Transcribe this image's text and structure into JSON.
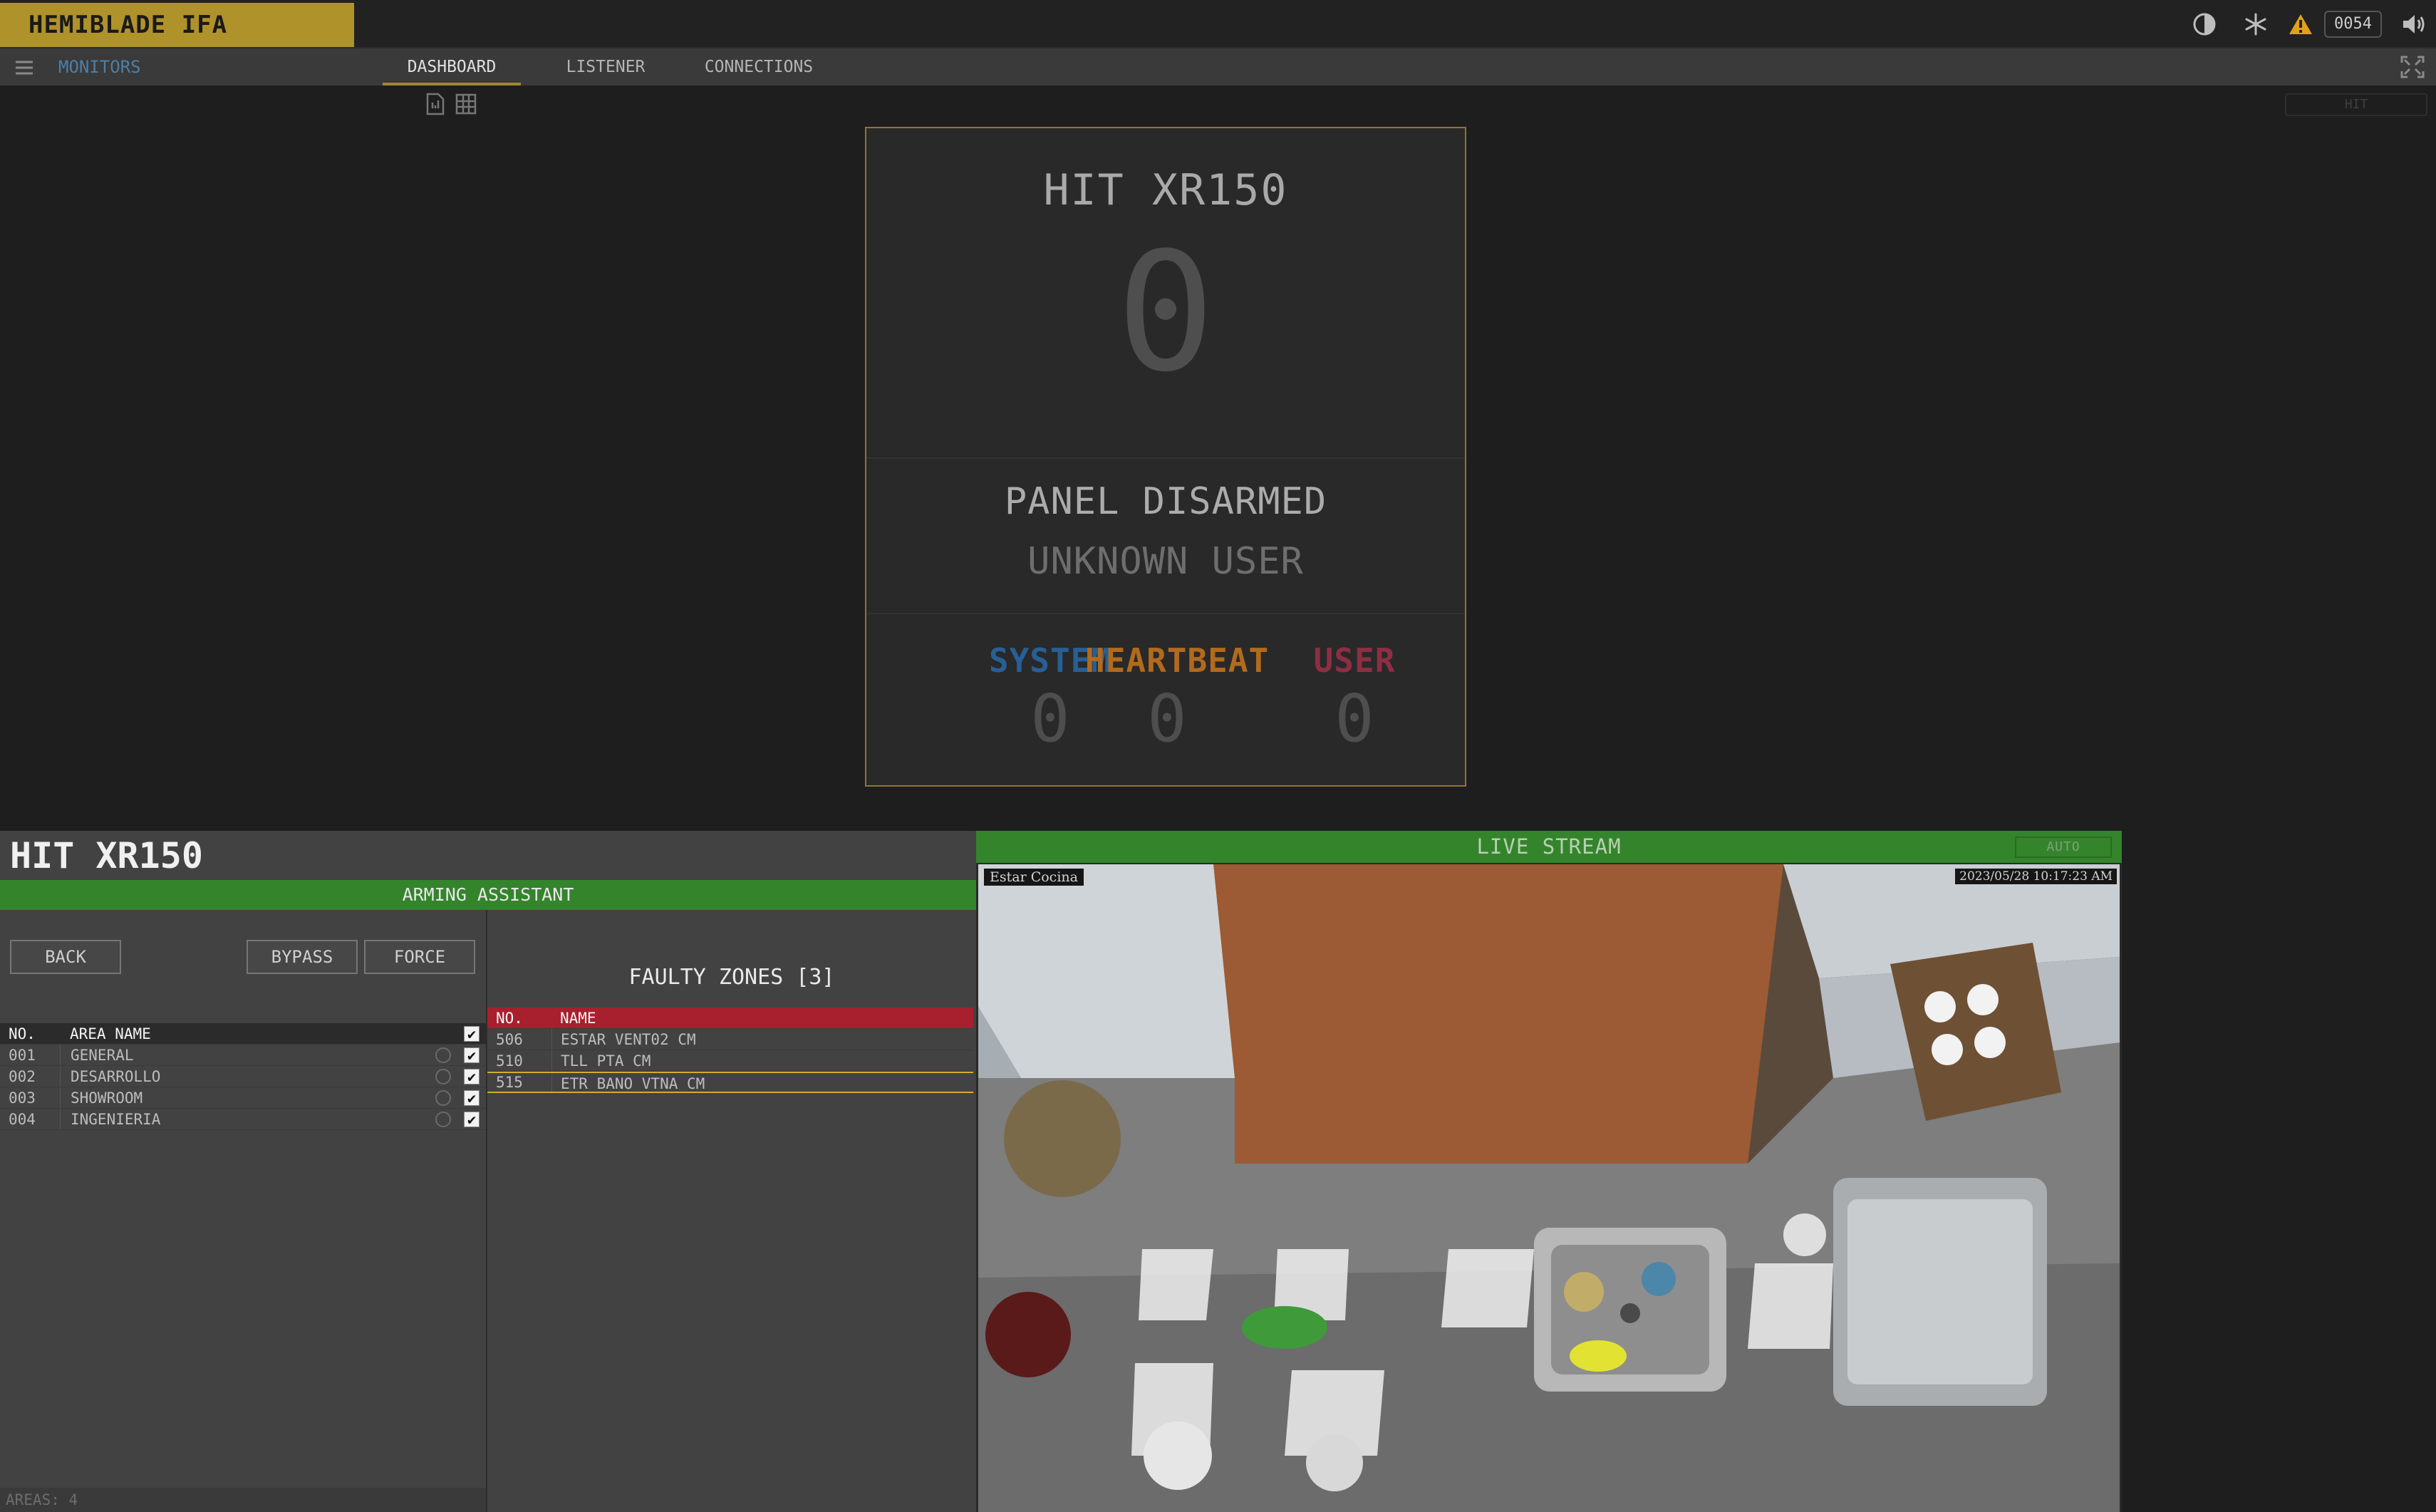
{
  "app": {
    "brand": "HEMIBLADE IFA",
    "counter": "0054"
  },
  "icons": {
    "contrast": "contrast-icon",
    "sync": "snowflake-icon",
    "alert": "warning-icon",
    "sound": "speaker-icon",
    "menu": "hamburger-icon",
    "fullscreen": "fullscreen-icon",
    "report": "report-icon",
    "grid": "grid-icon"
  },
  "colors": {
    "brand": "#b0922a",
    "accent_green": "#34842c",
    "fault_red": "#a8202e",
    "system_blue": "#275f96",
    "heartbeat_orange": "#b26a1c",
    "user_red": "#8d2e43",
    "selection_gold": "#d2ad2f",
    "alert_orange": "#e0a01c"
  },
  "nav": {
    "monitors": "MONITORS",
    "tabs": [
      {
        "label": "DASHBOARD",
        "active": true
      },
      {
        "label": "LISTENER",
        "active": false
      },
      {
        "label": "CONNECTIONS",
        "active": false
      }
    ],
    "filter_placeholder": "HIT"
  },
  "panel": {
    "model": "HIT XR150",
    "count": "0",
    "state": "PANEL DISARMED",
    "user": "UNKNOWN USER",
    "stats": [
      {
        "label": "SYSTEM",
        "value": "0"
      },
      {
        "label": "HEARTBEAT",
        "value": "0"
      },
      {
        "label": "USER",
        "value": "0"
      }
    ]
  },
  "arming": {
    "title": "HIT XR150",
    "assistant_label": "ARMING ASSISTANT",
    "buttons": {
      "back": "BACK",
      "bypass": "BYPASS",
      "force": "FORCE"
    },
    "areas_columns": [
      "NO.",
      "AREA NAME"
    ],
    "areas": [
      {
        "no": "001",
        "name": "GENERAL",
        "checked": true
      },
      {
        "no": "002",
        "name": "DESARROLLO",
        "checked": true
      },
      {
        "no": "003",
        "name": "SHOWROOM",
        "checked": true
      },
      {
        "no": "004",
        "name": "INGENIERIA",
        "checked": true
      }
    ],
    "areas_footer": {
      "label": "AREAS:",
      "count": "4"
    },
    "faulty_title": "FAULTY ZONES [3]",
    "zones_columns": [
      "NO.",
      "NAME"
    ],
    "zones": [
      {
        "no": "506",
        "name": "ESTAR VENT02 CM",
        "selected": false
      },
      {
        "no": "510",
        "name": "TLL PTA CM",
        "selected": false
      },
      {
        "no": "515",
        "name": "ETR BANO VTNA CM",
        "selected": true
      }
    ]
  },
  "stream": {
    "title": "LIVE STREAM",
    "mode": "AUTO",
    "camera_name": "Estar Cocina",
    "timestamp": "2023/05/28 10:17:23 AM"
  }
}
